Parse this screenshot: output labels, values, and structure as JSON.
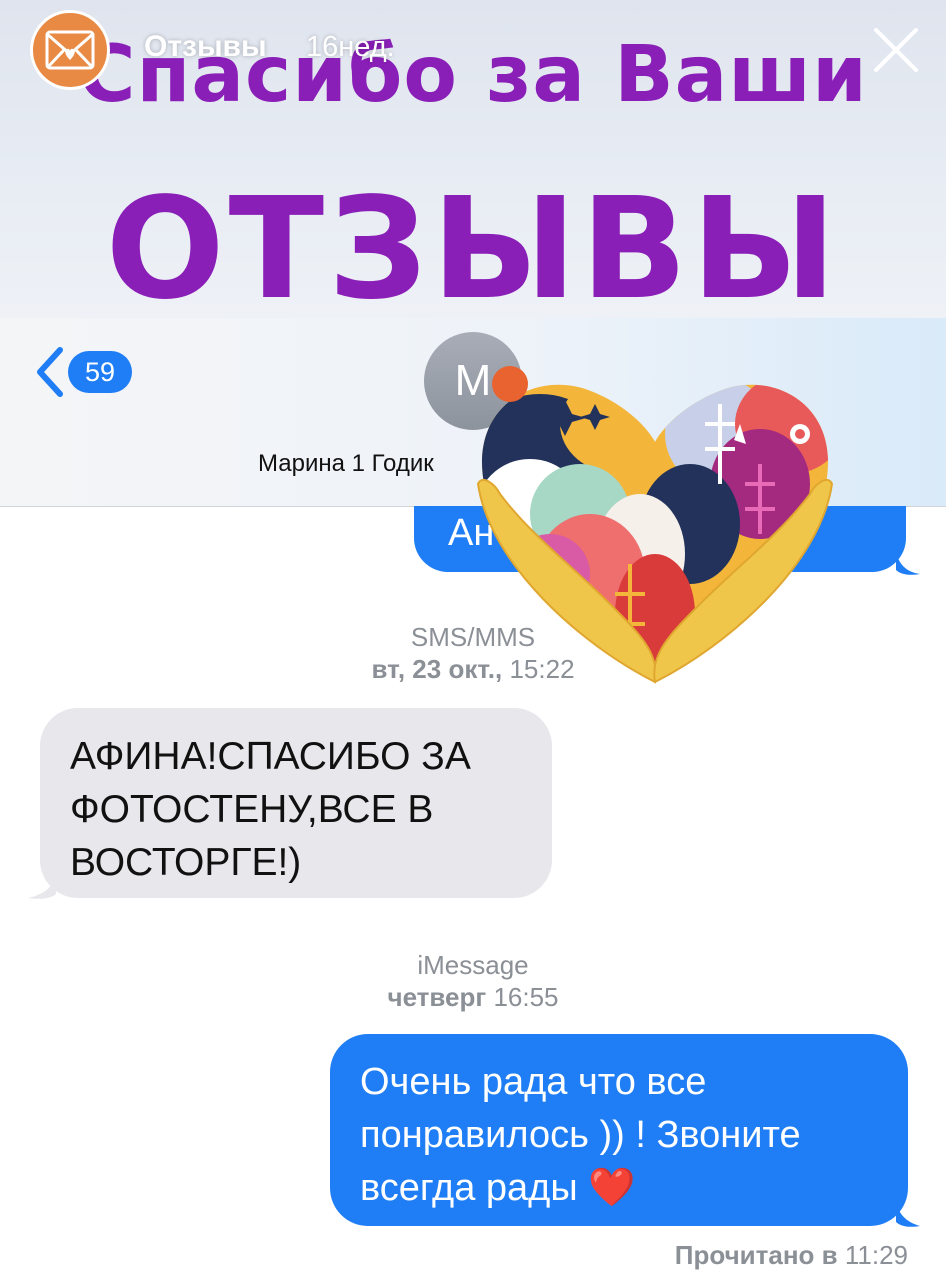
{
  "story": {
    "title": "Отзывы",
    "age": "16нед.",
    "banner_line1": "Спасибо за Ваши",
    "banner_line2": "ОТЗЫВЫ"
  },
  "nav": {
    "badge": "59",
    "avatar_initial": "М",
    "contact_name": "Марина 1 Годик"
  },
  "messages": {
    "partial_bubble_text": "Ан",
    "sms_label": "SMS/MMS",
    "sms_time_bold": "вт, 23 окт.,",
    "sms_time": " 15:22",
    "incoming_lines": [
      "АФИНА!СПАСИБО ЗА",
      "ФОТОСТЕНУ,ВСЕ В",
      "ВОСТОРГЕ!)"
    ],
    "imessage_label": "iMessage",
    "imessage_time_bold": "четверг",
    "imessage_time": " 16:55",
    "outgoing_lines": [
      "Очень рада что все",
      "понравилось )) ! Звоните",
      "всегда рады ❤️"
    ],
    "read_receipt_bold": "Прочитано в",
    "read_receipt_time": " 11:29"
  },
  "colors": {
    "banner_text": "#8a1fb8",
    "imessage_blue": "#1f7ef5",
    "incoming_bubble": "#e7e7ec",
    "meta_gray": "#8b8f96"
  },
  "icons": [
    "mail-heart-icon",
    "close-icon",
    "back-chevron-icon",
    "heart-hands-sticker"
  ]
}
